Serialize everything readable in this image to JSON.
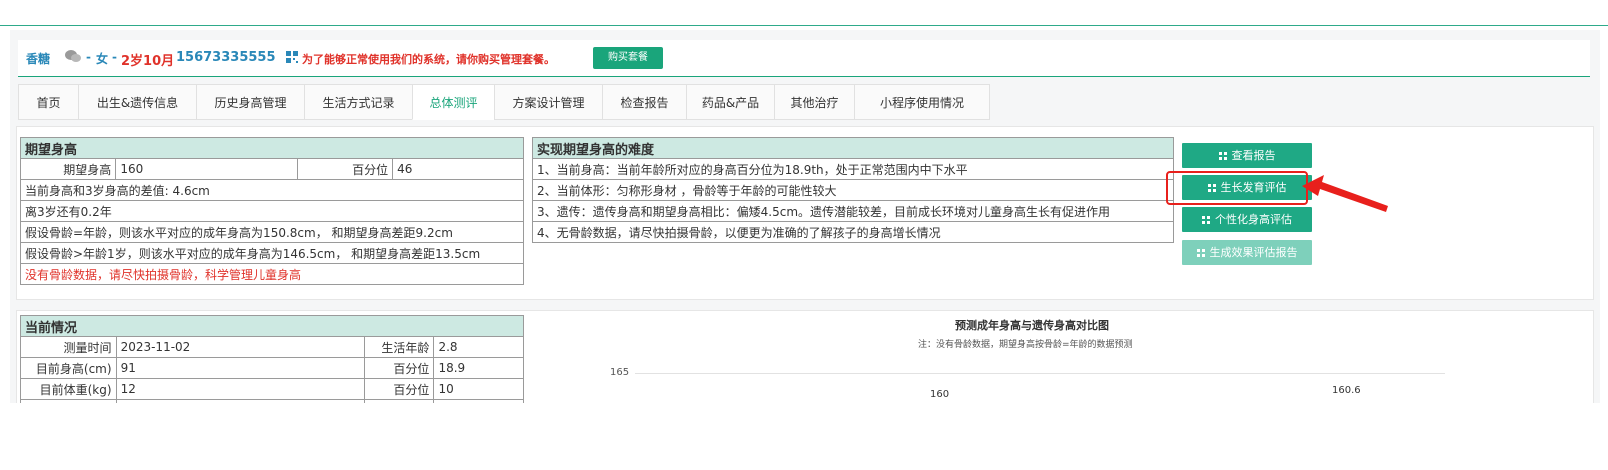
{
  "header": {
    "name": "香糖",
    "sep": "-",
    "sex": "女",
    "age": "2岁10月",
    "phone": "15673335555",
    "notice": "为了能够正常使用我们的系统，请你购买管理套餐。",
    "buy_label": "购买套餐",
    "icons": [
      "wechat-icon",
      "qr-icon"
    ]
  },
  "tabs": [
    {
      "label": "首页"
    },
    {
      "label": "出生&遗传信息"
    },
    {
      "label": "历史身高管理"
    },
    {
      "label": "生活方式记录"
    },
    {
      "label": "总体测评",
      "active": true
    },
    {
      "label": "方案设计管理"
    },
    {
      "label": "检查报告"
    },
    {
      "label": "药品&产品"
    },
    {
      "label": "其他治疗"
    },
    {
      "label": "小程序使用情况"
    }
  ],
  "expected": {
    "title": "期望身高",
    "height_label": "期望身高",
    "height_value": "160",
    "percentile_label": "百分位",
    "percentile_value": "46",
    "rows": [
      "当前身高和3岁身高的差值: 4.6cm",
      "离3岁还有0.2年",
      "假设骨龄=年龄，则该水平对应的成年身高为150.8cm， 和期望身高差距9.2cm",
      "假设骨龄>年龄1岁，则该水平对应的成年身高为146.5cm， 和期望身高差距13.5cm"
    ],
    "warning": "没有骨龄数据，请尽快拍摄骨龄，科学管理儿童身高"
  },
  "difficulty": {
    "title": "实现期望身高的难度",
    "rows": [
      "1、当前身高：当前年龄所对应的身高百分位为18.9th，处于正常范围内中下水平",
      "2、当前体形：匀称形身材 ，骨龄等于年龄的可能性较大",
      "3、遗传：遗传身高和期望身高相比：偏矮4.5cm。遗传潜能较差，目前成长环境对儿童身高生长有促进作用",
      "4、无骨龄数据，请尽快拍摄骨龄，以便更为准确的了解孩子的身高增长情况"
    ]
  },
  "actions": {
    "view_report": "查看报告",
    "growth_eval": "生长发育评估",
    "personal_eval": "个性化身高评估",
    "effect_report": "生成效果评估报告"
  },
  "current": {
    "title": "当前情况",
    "rows": [
      {
        "label": "测量时间",
        "value": "2023-11-02",
        "label2": "生活年龄",
        "value2": "2.8"
      },
      {
        "label": "目前身高(cm)",
        "value": "91",
        "label2": "百分位",
        "value2": "18.9"
      },
      {
        "label": "目前体重(kg)",
        "value": "12",
        "label2": "百分位",
        "value2": "10"
      }
    ]
  },
  "chart": {
    "title": "预测成年身高与遗传身高对比图",
    "note": "注：没有骨龄数据，期望身高按骨龄=年龄的数据预测",
    "tick_165": "165"
  },
  "chart_data": {
    "type": "bar",
    "title": "预测成年身高与遗传身高对比图",
    "subtitle": "注：没有骨龄数据，期望身高按骨龄=年龄的数据预测",
    "ylim_visible_top": 165,
    "y_ticks": [
      165
    ],
    "data_labels": [
      "160",
      "160.6"
    ],
    "values": [
      160,
      160.6
    ]
  },
  "colors": {
    "accent": "#1aa57b",
    "link": "#2a88b8",
    "warning": "#e0322a",
    "table_header": "#cde9e2"
  }
}
